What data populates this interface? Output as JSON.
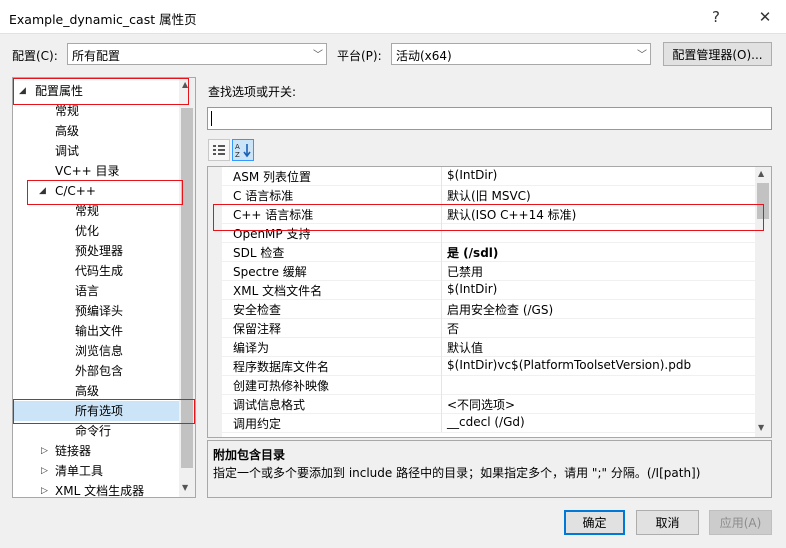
{
  "window": {
    "title": "Example_dynamic_cast 属性页",
    "help_glyph": "?",
    "close_glyph": "✕"
  },
  "top_bar": {
    "config_label": "配置(C):",
    "config_value": "所有配置",
    "platform_label": "平台(P):",
    "platform_value": "活动(x64)",
    "manager_button": "配置管理器(O)..."
  },
  "tree": {
    "items": [
      {
        "label": "配置属性",
        "expand": "◢"
      },
      {
        "label": "常规",
        "expand": ""
      },
      {
        "label": "高级",
        "expand": ""
      },
      {
        "label": "调试",
        "expand": ""
      },
      {
        "label": "VC++ 目录",
        "expand": ""
      },
      {
        "label": "C/C++",
        "expand": "◢"
      },
      {
        "label": "常规",
        "expand": ""
      },
      {
        "label": "优化",
        "expand": ""
      },
      {
        "label": "预处理器",
        "expand": ""
      },
      {
        "label": "代码生成",
        "expand": ""
      },
      {
        "label": "语言",
        "expand": ""
      },
      {
        "label": "预编译头",
        "expand": ""
      },
      {
        "label": "输出文件",
        "expand": ""
      },
      {
        "label": "浏览信息",
        "expand": ""
      },
      {
        "label": "外部包含",
        "expand": ""
      },
      {
        "label": "高级",
        "expand": ""
      },
      {
        "label": "所有选项",
        "expand": ""
      },
      {
        "label": "命令行",
        "expand": ""
      },
      {
        "label": "链接器",
        "expand": "▷"
      },
      {
        "label": "清单工具",
        "expand": "▷"
      },
      {
        "label": "XML 文档生成器",
        "expand": "▷"
      }
    ],
    "selected_index": 16
  },
  "search": {
    "label": "查找选项或开关:",
    "value": ""
  },
  "properties": [
    {
      "name": "ASM 列表位置",
      "value": "$(IntDir)",
      "bold": false
    },
    {
      "name": "C 语言标准",
      "value": "默认(旧 MSVC)",
      "bold": false
    },
    {
      "name": "C++ 语言标准",
      "value": "默认(ISO C++14 标准)",
      "bold": false
    },
    {
      "name": "OpenMP 支持",
      "value": "",
      "bold": false
    },
    {
      "name": "SDL 检查",
      "value": "是 (/sdl)",
      "bold": true
    },
    {
      "name": "Spectre 缓解",
      "value": "已禁用",
      "bold": false
    },
    {
      "name": "XML 文档文件名",
      "value": "$(IntDir)",
      "bold": false
    },
    {
      "name": "安全检查",
      "value": "启用安全检查 (/GS)",
      "bold": false
    },
    {
      "name": "保留注释",
      "value": "否",
      "bold": false
    },
    {
      "name": "编译为",
      "value": "默认值",
      "bold": false
    },
    {
      "name": "程序数据库文件名",
      "value": "$(IntDir)vc$(PlatformToolsetVersion).pdb",
      "bold": false
    },
    {
      "name": "创建可热修补映像",
      "value": "",
      "bold": false
    },
    {
      "name": "调试信息格式",
      "value": "<不同选项>",
      "bold": false
    },
    {
      "name": "调用约定",
      "value": "__cdecl (/Gd)",
      "bold": false
    }
  ],
  "description": {
    "title": "附加包含目录",
    "text": "指定一个或多个要添加到 include 路径中的目录；如果指定多个，请用 \";\" 分隔。(/I[path])"
  },
  "buttons": {
    "ok": "确定",
    "cancel": "取消",
    "apply": "应用(A)"
  },
  "colors": {
    "highlight_red": "#e8121b",
    "selection": "#cce4f7",
    "accent": "#0078d7"
  }
}
